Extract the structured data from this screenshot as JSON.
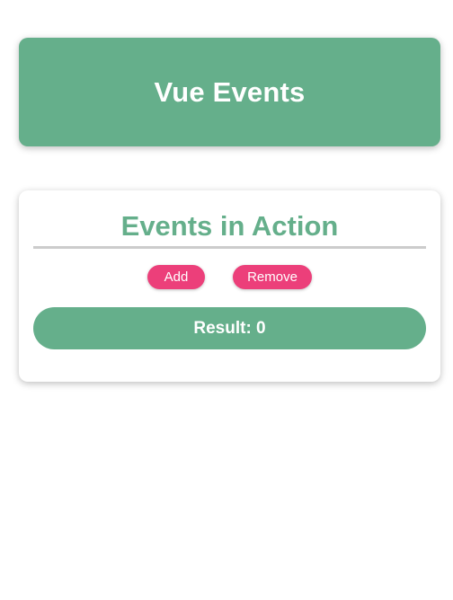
{
  "header": {
    "title": "Vue Events"
  },
  "card": {
    "title": "Events in Action",
    "add_label": "Add",
    "remove_label": "Remove",
    "result_label": "Result: 0"
  },
  "colors": {
    "primary": "#65af8b",
    "button": "#ec3f7a",
    "divider": "#cccccc"
  }
}
